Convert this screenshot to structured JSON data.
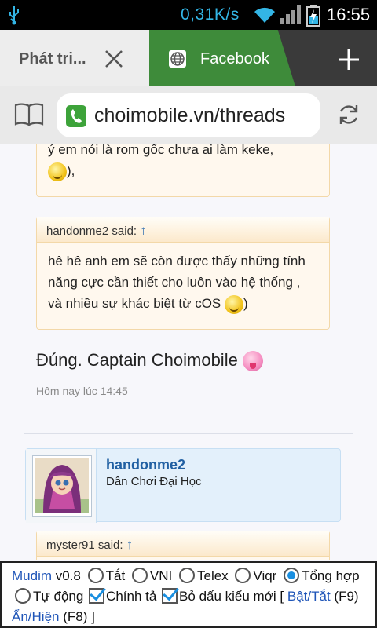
{
  "status_bar": {
    "network_speed": "0,31K/s",
    "clock": "16:55"
  },
  "tabs": [
    {
      "title": "Phát tri...",
      "active": false
    },
    {
      "title": "Facebook",
      "active": true
    }
  ],
  "url_bar": {
    "url": "choimobile.vn/threads"
  },
  "thread": {
    "top_quote_text": "ý em nói là rom gốc chưa ai làm keke,",
    "top_quote_tail": "),",
    "quote2": {
      "author_said": "handonme2 said:",
      "arrow": "↑",
      "text": "hê hê anh em sẽ còn được thấy những tính năng cực cần thiết cho luôn vào hệ thống , và nhiều sự khác biệt từ cOS",
      "tail": ")"
    },
    "message": "Đúng. Captain Choimobile",
    "timestamp": "Hôm nay lúc 14:45",
    "next_post": {
      "username": "handonme2",
      "user_title": "Dân Chơi Đại Học",
      "quote_author_said": "myster91 said:",
      "arrow": "↑"
    }
  },
  "mudim": {
    "brand": "Mudim",
    "version": "v0.8",
    "modes": [
      "Tắt",
      "VNI",
      "Telex",
      "Viqr",
      "Tổng hợp",
      "Tự động"
    ],
    "selected_mode": "Tổng hợp",
    "check_spelling": "Chính tả",
    "new_accent": "Bỏ dấu kiểu mới",
    "toggle_link": "Bật/Tắt",
    "toggle_key": "(F9)",
    "showhide_link": "Ẩn/Hiện",
    "showhide_key": "(F8)",
    "bracket_open": "[",
    "bracket_close": "]"
  },
  "colors": {
    "accent_tab": "#3e8b3a",
    "status_blue": "#33b5e5",
    "link_blue": "#2160a3"
  }
}
